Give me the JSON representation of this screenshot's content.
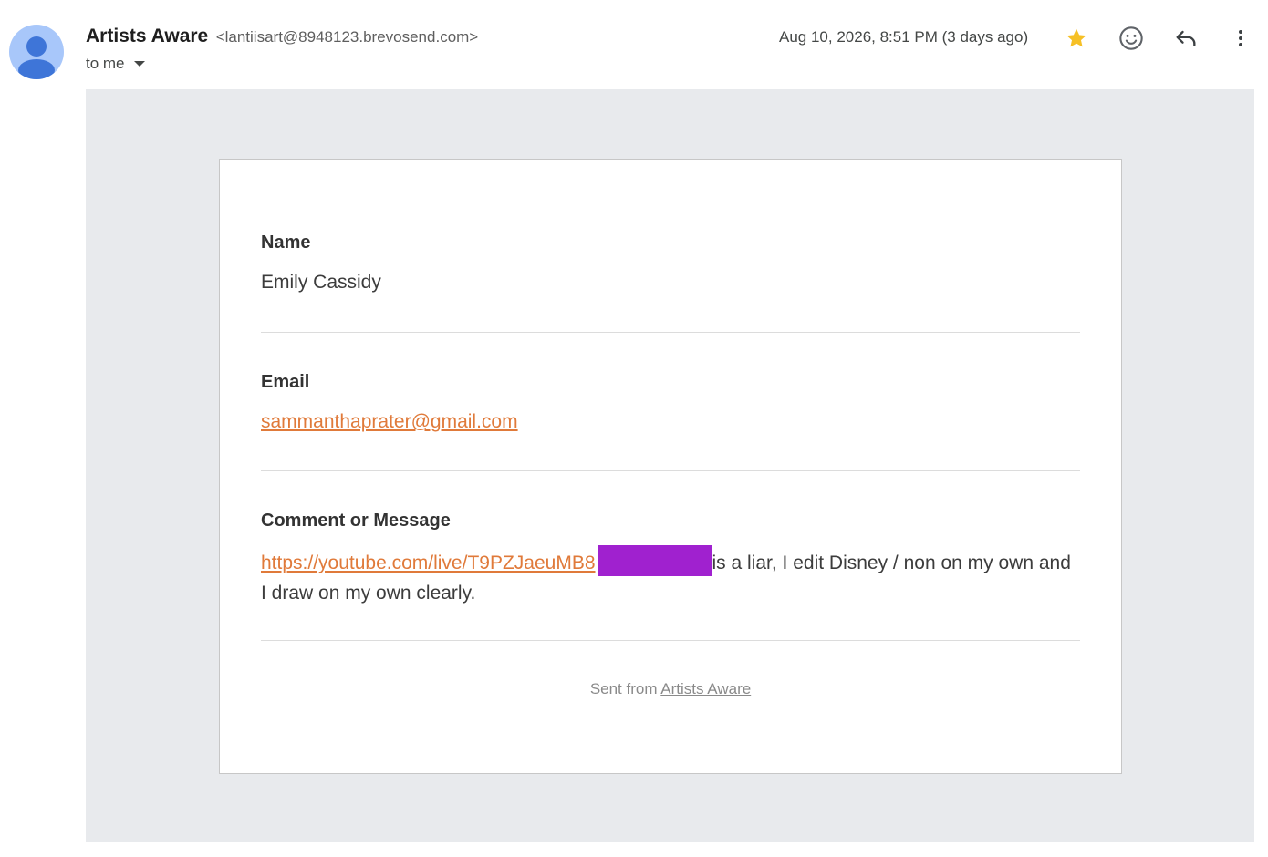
{
  "header": {
    "sender_name": "Artists Aware",
    "sender_email": "<lantiisart@8948123.brevosend.com>",
    "recipient": "to me",
    "timestamp": "Aug 10, 2026, 8:51 PM (3 days ago)",
    "icons": {
      "avatar": "person-avatar-icon",
      "star": "star-icon",
      "emoji": "emoji-reaction-icon",
      "reply": "reply-icon",
      "more": "more-vertical-icon"
    },
    "colors": {
      "star": "#f6c026",
      "avatar_bg": "#a8c7fa",
      "avatar_fg": "#3e75d8"
    }
  },
  "message": {
    "fields": [
      {
        "label": "Name",
        "value": "Emily Cassidy"
      },
      {
        "label": "Email",
        "value": "sammanthaprater@gmail.com"
      },
      {
        "label": "Comment or Message",
        "link": "https://youtube.com/live/T9PZJaeuMB8",
        "text_after": "is a liar, I edit Disney / non on my own and I draw on my own clearly."
      }
    ],
    "footer_prefix": "Sent from ",
    "footer_link": "Artists Aware",
    "colors": {
      "link": "#e07a3a",
      "redaction": "#a021cf",
      "background": "#e8eaed"
    }
  }
}
